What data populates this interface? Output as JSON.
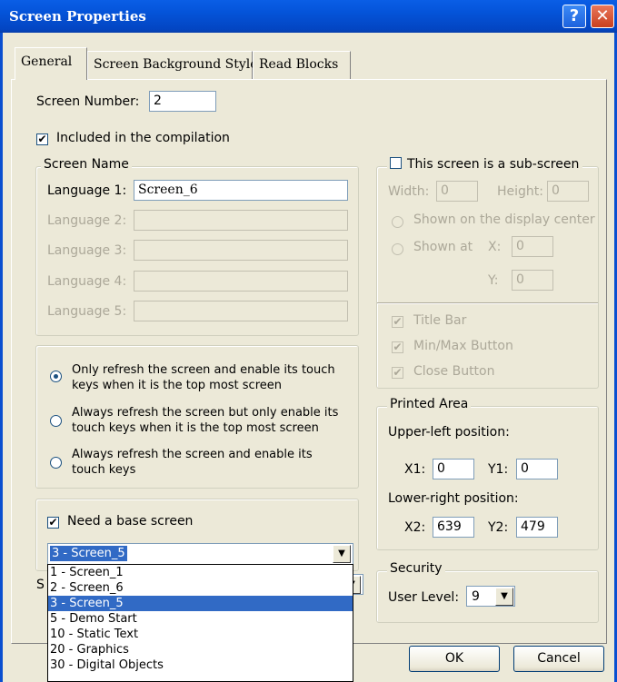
{
  "window": {
    "title": "Screen Properties",
    "help_glyph": "?",
    "close_glyph": "✕"
  },
  "tabs": [
    {
      "label": "General"
    },
    {
      "label": "Screen Background Style"
    },
    {
      "label": "Read Blocks"
    }
  ],
  "general": {
    "screen_number_label": "Screen Number:",
    "screen_number_value": "2",
    "included_label": "Included in the compilation",
    "included_checked": true,
    "screen_name": {
      "legend": "Screen Name",
      "languages": [
        {
          "label": "Language 1:",
          "value": "Screen_6",
          "enabled": true
        },
        {
          "label": "Language 2:",
          "value": "",
          "enabled": false
        },
        {
          "label": "Language 3:",
          "value": "",
          "enabled": false
        },
        {
          "label": "Language 4:",
          "value": "",
          "enabled": false
        },
        {
          "label": "Language 5:",
          "value": "",
          "enabled": false
        }
      ]
    },
    "refresh_options": [
      {
        "line1": "Only refresh the screen and enable its touch",
        "line2": "keys when it is the top most screen",
        "selected": true
      },
      {
        "line1": "Always refresh the screen but only enable its",
        "line2": "touch keys when it is the top most screen",
        "selected": false
      },
      {
        "line1": "Always refresh the screen and enable its",
        "line2": "touch keys",
        "selected": false
      }
    ],
    "base_screen": {
      "checkbox_label": "Need a base screen",
      "checked": true,
      "selected": "3 - Screen_5",
      "options": [
        "1 - Screen_1",
        "2 - Screen_6",
        "3 - Screen_5",
        "5 - Demo Start",
        "10 - Static Text",
        "20 - Graphics",
        "30 - Digital Objects"
      ],
      "selected_index": 2
    },
    "partial_label": "S"
  },
  "sub_screen": {
    "checkbox_label": "This screen is a sub-screen",
    "checked": false,
    "width_label": "Width:",
    "width_value": "0",
    "height_label": "Height:",
    "height_value": "0",
    "shown_center_label": "Shown on the display center",
    "shown_at_label": "Shown at",
    "x_label": "X:",
    "x_value": "0",
    "y_label": "Y:",
    "y_value": "0",
    "title_bar_label": "Title Bar",
    "minmax_label": "Min/Max Button",
    "close_label": "Close Button"
  },
  "printed_area": {
    "legend": "Printed Area",
    "upper_left_label": "Upper-left position:",
    "x1_label": "X1:",
    "x1_value": "0",
    "y1_label": "Y1:",
    "y1_value": "0",
    "lower_right_label": "Lower-right position:",
    "x2_label": "X2:",
    "x2_value": "639",
    "y2_label": "Y2:",
    "y2_value": "479"
  },
  "security": {
    "legend": "Security",
    "user_level_label": "User Level:",
    "user_level_value": "9"
  },
  "buttons": {
    "ok": "OK",
    "cancel": "Cancel"
  },
  "icons": {
    "check": "✔",
    "dropdown": "▼"
  }
}
